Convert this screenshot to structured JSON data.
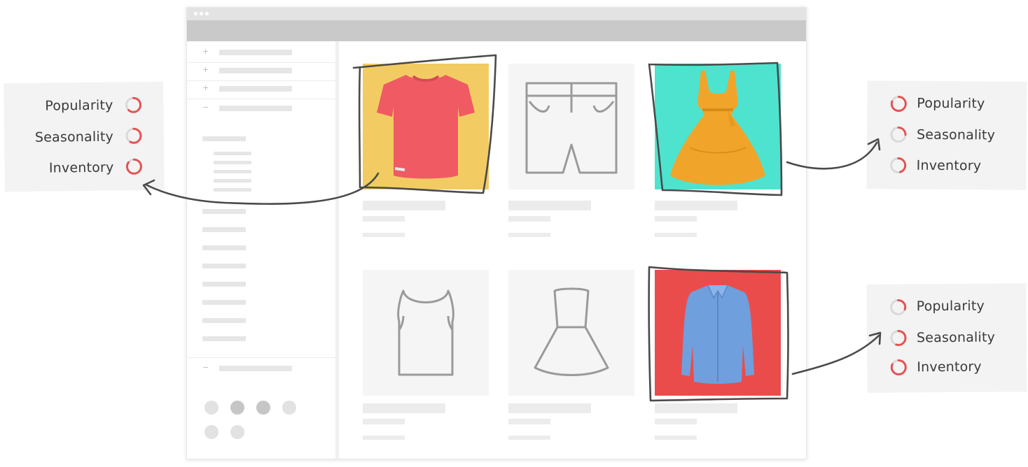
{
  "colors": {
    "accent_red": "#e55353",
    "ring_grey": "#d9d9d9",
    "tile_yellow": "#f2cc63",
    "tile_teal": "#4ee3cf",
    "tile_red": "#ea4c4c",
    "sketch_stroke": "#4a4a4a",
    "outline_grey": "#9a9a9a"
  },
  "products": [
    {
      "id": "tshirt",
      "state": "highlighted",
      "icon": "red-tshirt-image",
      "bg": "tile_yellow"
    },
    {
      "id": "shorts",
      "state": "placeholder",
      "icon": "shorts-outline-icon",
      "bg": ""
    },
    {
      "id": "dress",
      "state": "highlighted",
      "icon": "orange-dress-image",
      "bg": "tile_teal"
    },
    {
      "id": "tank-top",
      "state": "placeholder",
      "icon": "tank-top-outline-icon",
      "bg": ""
    },
    {
      "id": "skirt-dress",
      "state": "placeholder",
      "icon": "dress-outline-icon",
      "bg": ""
    },
    {
      "id": "shirt",
      "state": "highlighted",
      "icon": "blue-shirt-image",
      "bg": "tile_red"
    }
  ],
  "score_cards": {
    "left": {
      "metrics": [
        {
          "label": "Popularity",
          "score": 0.62
        },
        {
          "label": "Seasonality",
          "score": 0.58
        },
        {
          "label": "Inventory",
          "score": 0.85
        }
      ]
    },
    "right_top": {
      "metrics": [
        {
          "label": "Popularity",
          "score": 0.8
        },
        {
          "label": "Seasonality",
          "score": 0.25
        },
        {
          "label": "Inventory",
          "score": 0.45
        }
      ]
    },
    "right_bottom": {
      "metrics": [
        {
          "label": "Popularity",
          "score": 0.3
        },
        {
          "label": "Seasonality",
          "score": 0.55
        },
        {
          "label": "Inventory",
          "score": 0.82
        }
      ]
    }
  }
}
